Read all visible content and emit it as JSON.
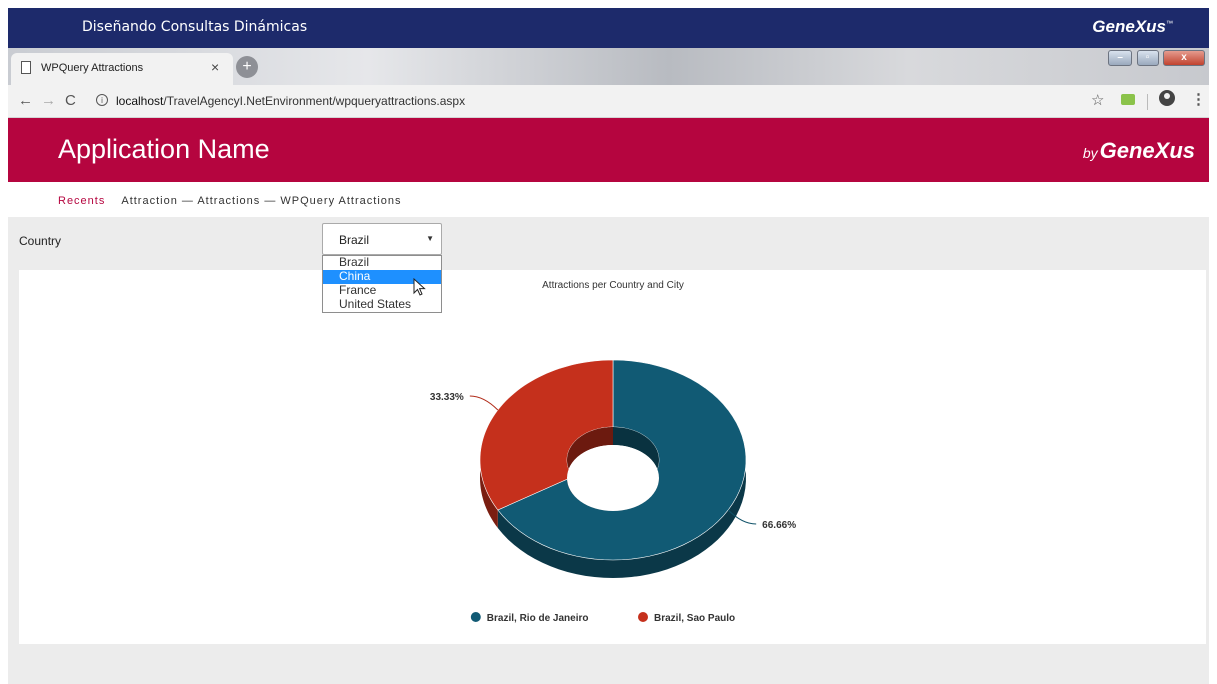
{
  "banner": {
    "title": "Diseñando Consultas Dinámicas",
    "logo": "GeneXus",
    "logo_mark": "™"
  },
  "browser": {
    "tab_title": "WPQuery Attractions",
    "tab_close": "×",
    "new_tab": "+",
    "url_host": "localhost",
    "url_path": "/TravelAgencyI.NetEnvironment/wpqueryattractions.aspx",
    "window_buttons": {
      "minimize": "–",
      "maximize": "▫",
      "close": "x"
    },
    "nav_icons": {
      "back": "←",
      "forward": "→",
      "reload": "C",
      "star": "☆",
      "menu": "⋮",
      "info": "i"
    }
  },
  "app": {
    "name": "Application Name",
    "by": "by",
    "brand": "GeneXus"
  },
  "breadcrumb": {
    "recents": "Recents",
    "path": "Attraction — Attractions — WPQuery Attractions"
  },
  "filter": {
    "label": "Country",
    "selected": "Brazil",
    "options": [
      "Brazil",
      "China",
      "France",
      "United States"
    ],
    "highlighted_option": "China"
  },
  "chart_data": {
    "type": "pie",
    "title": "Attractions per Country and City",
    "categories": [
      "Brazil, Rio de Janeiro",
      "Brazil, Sao Paulo"
    ],
    "values": [
      66.66,
      33.33
    ],
    "labels": [
      "66.66%",
      "33.33%"
    ],
    "colors": [
      "#115a74",
      "#c5301c"
    ],
    "legend_position": "bottom"
  }
}
